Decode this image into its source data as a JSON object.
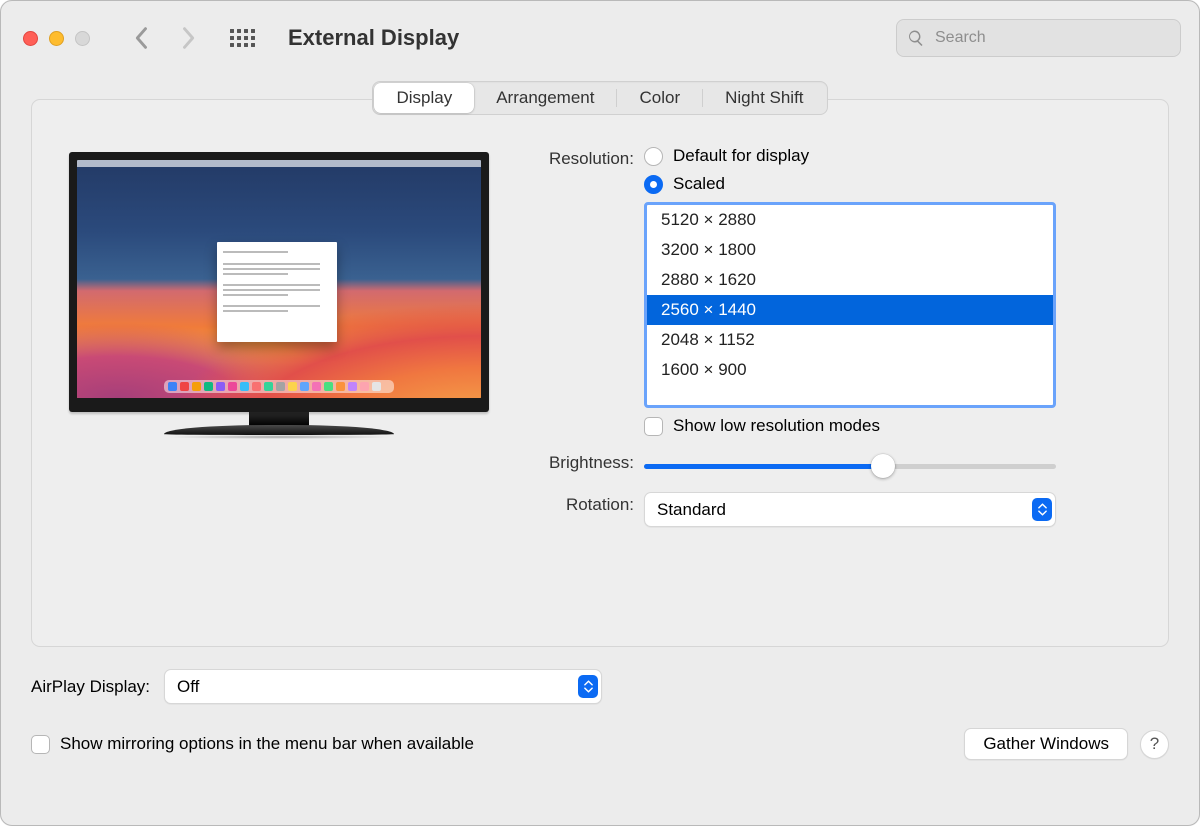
{
  "title": "External Display",
  "search": {
    "placeholder": "Search"
  },
  "tabs": {
    "display": "Display",
    "arrangement": "Arrangement",
    "color": "Color",
    "night_shift": "Night Shift",
    "active": "display"
  },
  "resolution": {
    "label": "Resolution:",
    "default_label": "Default for display",
    "scaled_label": "Scaled",
    "selected_mode": "scaled",
    "options": [
      "5120 × 2880",
      "3200 × 1800",
      "2880 × 1620",
      "2560 × 1440",
      "2048 × 1152",
      "1600 × 900"
    ],
    "selected_option_index": 3,
    "show_low_label": "Show low resolution modes",
    "show_low_checked": false
  },
  "brightness": {
    "label": "Brightness:",
    "value_percent": 58
  },
  "rotation": {
    "label": "Rotation:",
    "value": "Standard"
  },
  "airplay": {
    "label": "AirPlay Display:",
    "value": "Off"
  },
  "mirroring": {
    "label": "Show mirroring options in the menu bar when available",
    "checked": false
  },
  "gather_button": "Gather Windows",
  "help_button": "?",
  "dock_colors": [
    "#3b82f6",
    "#ef4444",
    "#f59e0b",
    "#10b981",
    "#8b5cf6",
    "#ec4899",
    "#38bdf8",
    "#f87171",
    "#34d399",
    "#a3a3a3",
    "#fcd34d",
    "#60a5fa",
    "#f472b6",
    "#4ade80",
    "#fb923c",
    "#c084fc",
    "#fda4af",
    "#e5e5e5"
  ]
}
